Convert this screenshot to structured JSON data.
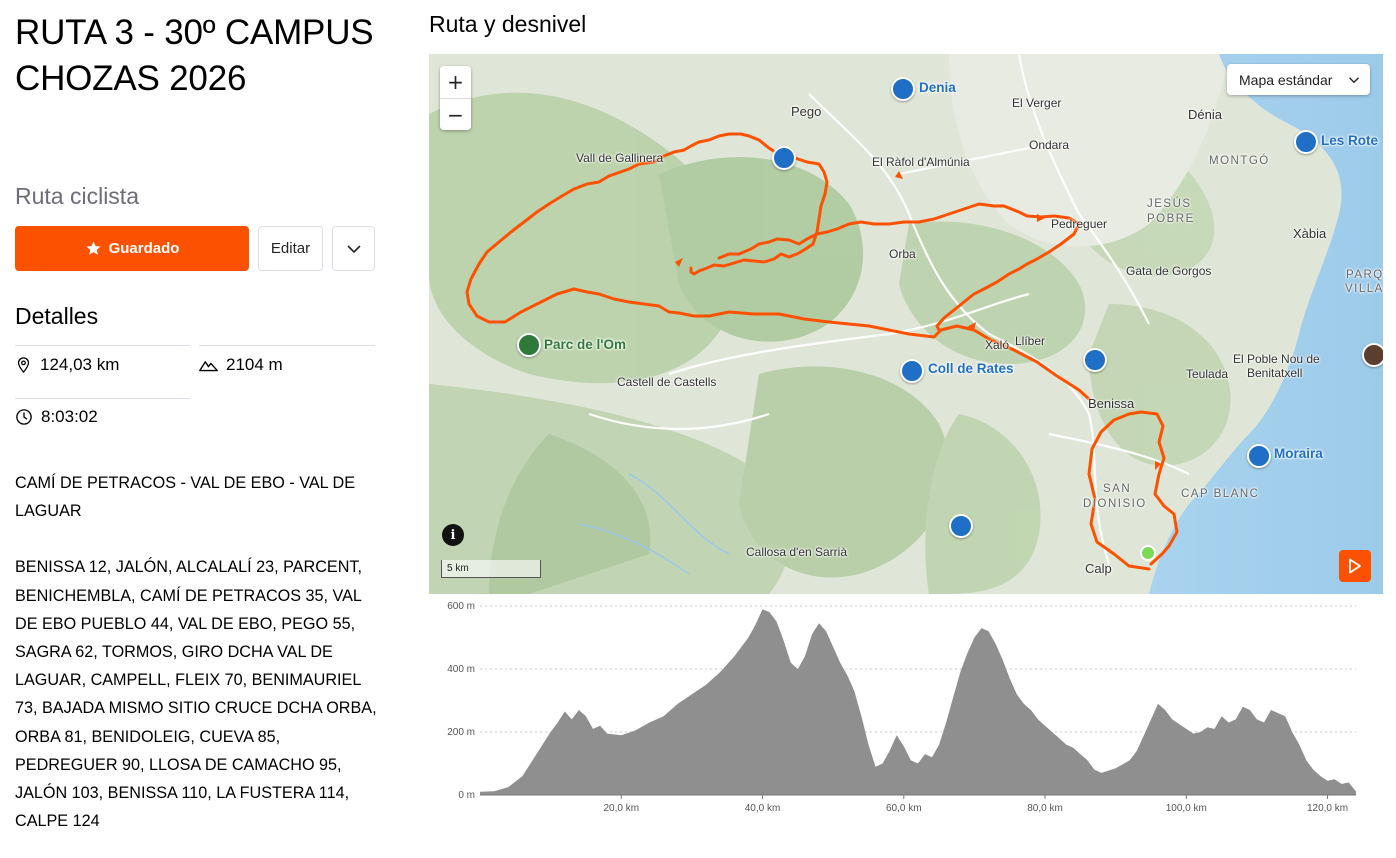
{
  "route": {
    "title": "RUTA 3 - 30º CAMPUS CHOZAS 2026",
    "type": "Ruta ciclista"
  },
  "actions": {
    "saved_label": "Guardado",
    "edit_label": "Editar"
  },
  "details": {
    "title": "Detalles",
    "distance": "124,03 km",
    "elevation": "2104 m",
    "time": "8:03:02"
  },
  "description": {
    "paragraph_1": "CAMÍ DE PETRACOS - VAL DE EBO - VAL DE LAGUAR",
    "paragraph_2": "BENISSA 12, JALÓN, ALCALALÍ 23, PARCENT, BENICHEMBLA, CAMÍ DE PETRACOS 35, VAL DE EBO PUEBLO 44, VAL DE EBO, PEGO 55, SAGRA 62, TORMOS, GIRO DCHA VAL DE LAGUAR, CAMPELL, FLEIX 70, BENIMAURIEL 73, BAJADA MISMO SITIO CRUCE DCHA ORBA, ORBA 81, BENIDOLEIG, CUEVA 85, PEDREGUER 90, LLOSA DE CAMACHO 95, JALÓN 103, BENISSA 110, LA FUSTERA 114, CALPE 124"
  },
  "map": {
    "section_title": "Ruta y desnivel",
    "map_type": "Mapa estándar",
    "zoom_in": "+",
    "zoom_out": "−",
    "info": "i",
    "scale": "5 km",
    "route_color": "#fc5200",
    "labels": {
      "pego": "Pego",
      "denia_poi": "Denia",
      "el_verger": "El Verger",
      "denia": "Dénia",
      "les_rotes": "Les Rote",
      "vall_gallinera": "Vall de Gallinera",
      "rafol": "El Ràfol d'Almúnia",
      "ondara": "Ondara",
      "montgo": "MONTGÓ",
      "jesus_pobre_1": "JESÚS",
      "jesus_pobre_2": "POBRE",
      "pedreguer": "Pedreguer",
      "xabia": "Xàbia",
      "orba": "Orba",
      "gata": "Gata de Gorgos",
      "parq_1": "PARQ",
      "parq_2": "VILLA",
      "parc_om": "Parc de l'Om",
      "xalo": "Xaló",
      "lliber": "Llíber",
      "coll_rates": "Coll de Rates",
      "castell": "Castell de Castells",
      "poble_nou_1": "El Poble Nou de",
      "poble_nou_2": "Benitatxell",
      "teulada": "Teulada",
      "benissa": "Benissa",
      "moraira": "Moraira",
      "san_dionisio_1": "SAN",
      "san_dionisio_2": "DIONISIO",
      "cap_blanc": "CAP BLANC",
      "callosa": "Callosa d'en Sarrià",
      "calp": "Calp"
    }
  },
  "elevation_profile": {
    "y_ticks": [
      "600 m",
      "400 m",
      "200 m",
      "0 m"
    ],
    "x_ticks": [
      "20,0 km",
      "40,0 km",
      "60,0 km",
      "80,0 km",
      "100,0 km",
      "120,0 km"
    ],
    "y_max": 600,
    "x_max": 124.03,
    "fill_color": "#8f8f8f",
    "points": [
      [
        0,
        10
      ],
      [
        2,
        12
      ],
      [
        4,
        25
      ],
      [
        6,
        60
      ],
      [
        8,
        130
      ],
      [
        10,
        200
      ],
      [
        11,
        230
      ],
      [
        12,
        265
      ],
      [
        13,
        240
      ],
      [
        14,
        270
      ],
      [
        15,
        250
      ],
      [
        16,
        210
      ],
      [
        17,
        220
      ],
      [
        18,
        195
      ],
      [
        20,
        190
      ],
      [
        22,
        205
      ],
      [
        24,
        230
      ],
      [
        26,
        250
      ],
      [
        28,
        290
      ],
      [
        30,
        320
      ],
      [
        32,
        350
      ],
      [
        34,
        390
      ],
      [
        36,
        440
      ],
      [
        38,
        500
      ],
      [
        39,
        540
      ],
      [
        40,
        590
      ],
      [
        41,
        580
      ],
      [
        42,
        550
      ],
      [
        43,
        490
      ],
      [
        44,
        420
      ],
      [
        45,
        400
      ],
      [
        46,
        440
      ],
      [
        47,
        510
      ],
      [
        48,
        545
      ],
      [
        49,
        520
      ],
      [
        50,
        470
      ],
      [
        51,
        420
      ],
      [
        52,
        380
      ],
      [
        53,
        330
      ],
      [
        54,
        250
      ],
      [
        55,
        160
      ],
      [
        56,
        90
      ],
      [
        57,
        100
      ],
      [
        58,
        140
      ],
      [
        59,
        190
      ],
      [
        60,
        155
      ],
      [
        61,
        110
      ],
      [
        62,
        100
      ],
      [
        63,
        130
      ],
      [
        64,
        120
      ],
      [
        65,
        160
      ],
      [
        66,
        230
      ],
      [
        67,
        310
      ],
      [
        68,
        390
      ],
      [
        69,
        450
      ],
      [
        70,
        500
      ],
      [
        71,
        530
      ],
      [
        72,
        520
      ],
      [
        73,
        480
      ],
      [
        74,
        430
      ],
      [
        75,
        370
      ],
      [
        76,
        320
      ],
      [
        77,
        290
      ],
      [
        78,
        270
      ],
      [
        79,
        240
      ],
      [
        80,
        220
      ],
      [
        81,
        200
      ],
      [
        82,
        180
      ],
      [
        83,
        160
      ],
      [
        84,
        150
      ],
      [
        85,
        130
      ],
      [
        86,
        110
      ],
      [
        87,
        80
      ],
      [
        88,
        70
      ],
      [
        90,
        85
      ],
      [
        92,
        110
      ],
      [
        93,
        140
      ],
      [
        94,
        190
      ],
      [
        95,
        240
      ],
      [
        96,
        290
      ],
      [
        97,
        270
      ],
      [
        98,
        240
      ],
      [
        99,
        225
      ],
      [
        100,
        210
      ],
      [
        101,
        195
      ],
      [
        102,
        200
      ],
      [
        103,
        215
      ],
      [
        104,
        210
      ],
      [
        105,
        250
      ],
      [
        106,
        230
      ],
      [
        107,
        240
      ],
      [
        108,
        280
      ],
      [
        109,
        270
      ],
      [
        110,
        240
      ],
      [
        111,
        230
      ],
      [
        112,
        270
      ],
      [
        113,
        260
      ],
      [
        114,
        250
      ],
      [
        115,
        200
      ],
      [
        116,
        160
      ],
      [
        117,
        110
      ],
      [
        118,
        80
      ],
      [
        119,
        60
      ],
      [
        120,
        45
      ],
      [
        121,
        50
      ],
      [
        122,
        35
      ],
      [
        123,
        40
      ],
      [
        124,
        12
      ]
    ]
  }
}
